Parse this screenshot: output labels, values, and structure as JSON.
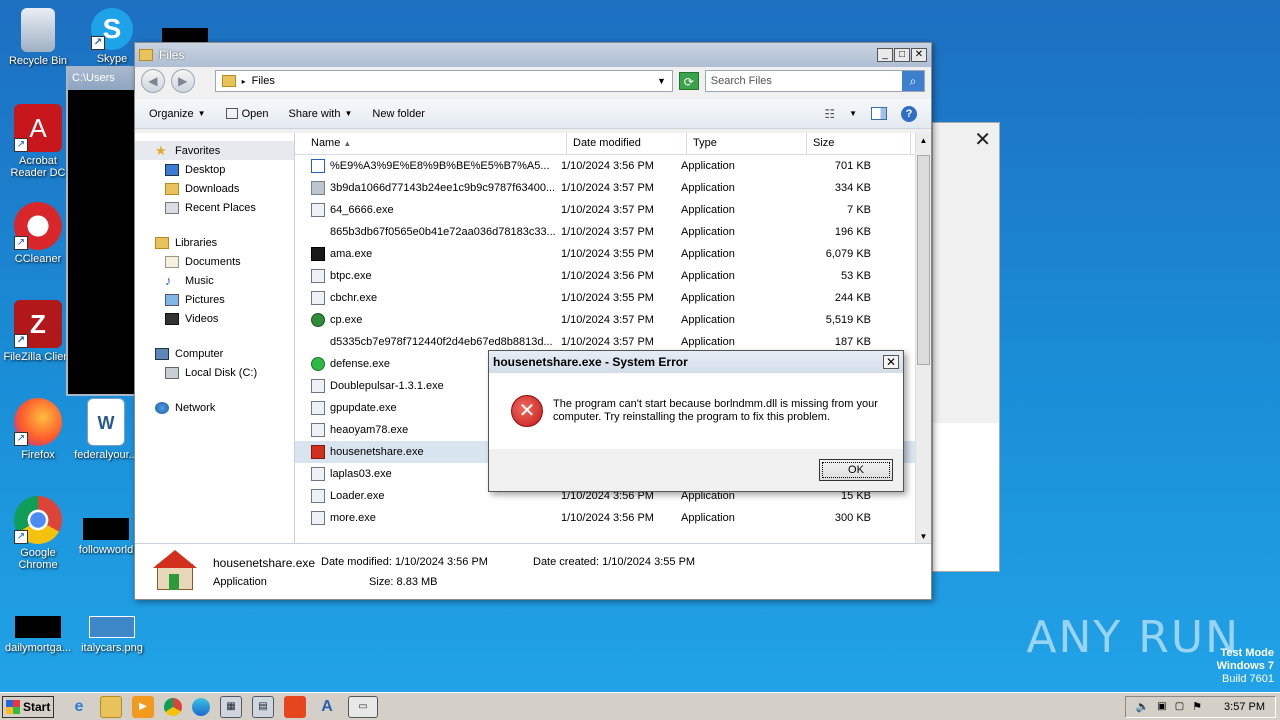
{
  "desktop": {
    "icons": [
      {
        "label": "Recycle Bin"
      },
      {
        "label": "Skype"
      },
      {
        "label": "Acrobat Reader DC"
      },
      {
        "label": "CCleaner"
      },
      {
        "label": "FileZilla Client"
      },
      {
        "label": "Firefox"
      },
      {
        "label": "federalyour..."
      },
      {
        "label": "Google Chrome"
      },
      {
        "label": "followworld"
      },
      {
        "label": "dailymortga..."
      },
      {
        "label": "italycars.png"
      }
    ],
    "console_title": "C:\\Users",
    "watermark": "ANY RUN",
    "test_mode": {
      "line1": "Test Mode",
      "line2": "Windows 7",
      "line3": "Build 7601"
    }
  },
  "explorer": {
    "title": "Files",
    "address": "Files",
    "search_placeholder": "Search Files",
    "toolbar": {
      "organize": "Organize",
      "open": "Open",
      "share_with": "Share with",
      "new_folder": "New folder"
    },
    "nav": {
      "favorites": "Favorites",
      "desktop": "Desktop",
      "downloads": "Downloads",
      "recent": "Recent Places",
      "libraries": "Libraries",
      "documents": "Documents",
      "music": "Music",
      "pictures": "Pictures",
      "videos": "Videos",
      "computer": "Computer",
      "local_disk": "Local Disk (C:)",
      "network": "Network"
    },
    "columns": {
      "name": "Name",
      "date": "Date modified",
      "type": "Type",
      "size": "Size"
    },
    "files": [
      {
        "name": "%E9%A3%9E%E8%9B%BE%E5%B7%A5...",
        "date": "1/10/2024 3:56 PM",
        "type": "Application",
        "size": "701 KB"
      },
      {
        "name": "3b9da1066d77143b24ee1c9b9c9787f63400...",
        "date": "1/10/2024 3:57 PM",
        "type": "Application",
        "size": "334 KB"
      },
      {
        "name": "64_6666.exe",
        "date": "1/10/2024 3:57 PM",
        "type": "Application",
        "size": "7 KB"
      },
      {
        "name": "865b3db67f0565e0b41e72aa036d78183c33...",
        "date": "1/10/2024 3:57 PM",
        "type": "Application",
        "size": "196 KB"
      },
      {
        "name": "ama.exe",
        "date": "1/10/2024 3:55 PM",
        "type": "Application",
        "size": "6,079 KB"
      },
      {
        "name": "btpc.exe",
        "date": "1/10/2024 3:56 PM",
        "type": "Application",
        "size": "53 KB"
      },
      {
        "name": "cbchr.exe",
        "date": "1/10/2024 3:55 PM",
        "type": "Application",
        "size": "244 KB"
      },
      {
        "name": "cp.exe",
        "date": "1/10/2024 3:57 PM",
        "type": "Application",
        "size": "5,519 KB"
      },
      {
        "name": "d5335cb7e978f712440f2d4eb67ed8b8813d...",
        "date": "1/10/2024 3:57 PM",
        "type": "Application",
        "size": "187 KB"
      },
      {
        "name": "defense.exe",
        "date": "",
        "type": "",
        "size": ""
      },
      {
        "name": "Doublepulsar-1.3.1.exe",
        "date": "",
        "type": "",
        "size": ""
      },
      {
        "name": "gpupdate.exe",
        "date": "",
        "type": "",
        "size": ""
      },
      {
        "name": "heaoyam78.exe",
        "date": "",
        "type": "",
        "size": ""
      },
      {
        "name": "housenetshare.exe",
        "date": "",
        "type": "",
        "size": ""
      },
      {
        "name": "laplas03.exe",
        "date": "",
        "type": "",
        "size": ""
      },
      {
        "name": "Loader.exe",
        "date": "1/10/2024 3:56 PM",
        "type": "Application",
        "size": "15 KB"
      },
      {
        "name": "more.exe",
        "date": "1/10/2024 3:56 PM",
        "type": "Application",
        "size": "300 KB"
      }
    ],
    "details": {
      "filename": "housenetshare.exe",
      "kind": "Application",
      "modified_label": "Date modified:",
      "modified": "1/10/2024 3:56 PM",
      "created_label": "Date created:",
      "created": "1/10/2024 3:55 PM",
      "size_label": "Size:",
      "size": "8.83 MB"
    }
  },
  "dialog": {
    "title": "housenetshare.exe - System Error",
    "message": "The program can't start because borlndmm.dll is missing from your computer. Try reinstalling the program to fix this problem.",
    "ok": "OK"
  },
  "taskbar": {
    "start": "Start",
    "clock": "3:57 PM"
  }
}
